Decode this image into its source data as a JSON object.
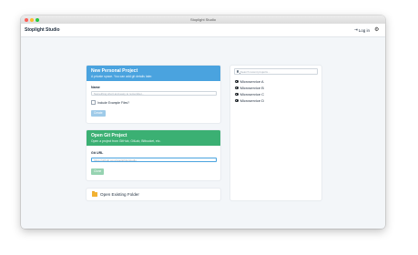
{
  "window": {
    "title": "Stoplight Studio"
  },
  "appbar": {
    "app_name": "Stoplight Studio",
    "login_label": "Log in"
  },
  "personal_project": {
    "title": "New Personal Project",
    "subtitle": "A private space. You can add git details later.",
    "name_label": "Name",
    "name_placeholder": "Something short and easy to remember...",
    "example_files_label": "Include Example Files?",
    "create_button": "Create"
  },
  "git_project": {
    "title": "Open Git Project",
    "subtitle": "Open a project from GitHub, GitLab, Bitbucket, etc.",
    "url_label": "Git URL",
    "url_placeholder": "https://github.com/stoplightio/studio",
    "clone_button": "Clone"
  },
  "folder": {
    "label": "Open Existing Folder"
  },
  "recent": {
    "search_placeholder": "Search recent projects...",
    "projects": [
      {
        "label": "Microservice A"
      },
      {
        "label": "Microservice B"
      },
      {
        "label": "Microservice C"
      },
      {
        "label": "Microservice D"
      }
    ]
  },
  "colors": {
    "accent_blue": "#4aa3df",
    "accent_green": "#3bb073",
    "folder": "#f2b233"
  }
}
